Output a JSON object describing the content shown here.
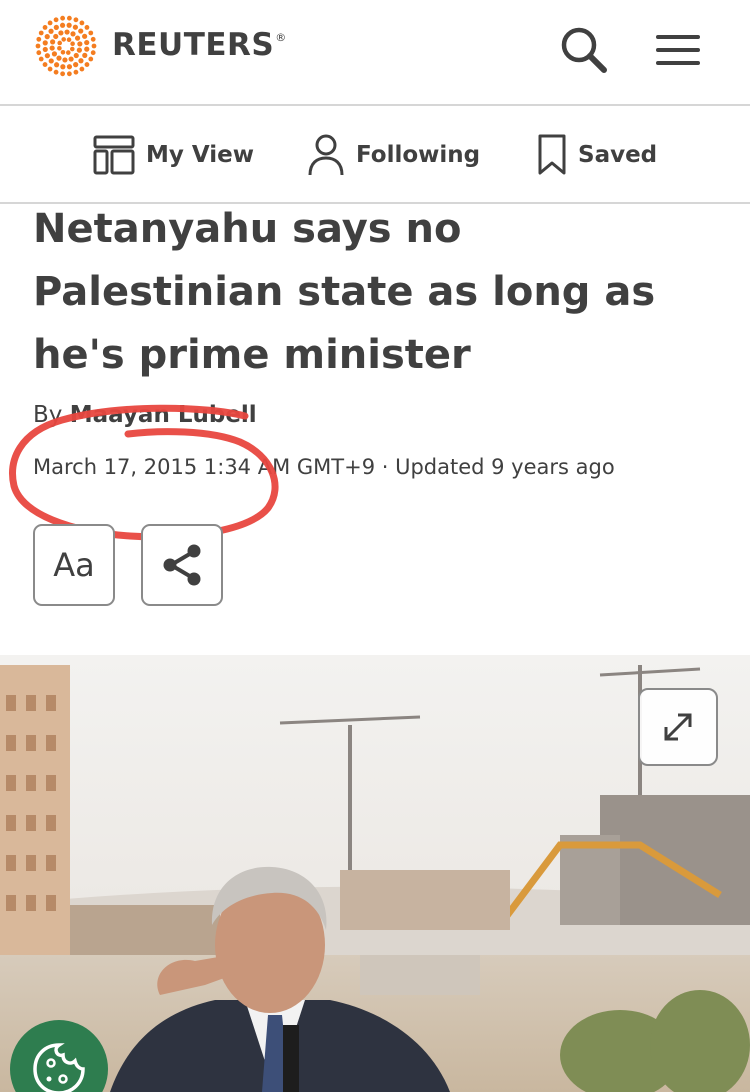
{
  "header": {
    "brand": "REUTERS",
    "brand_mark": "®",
    "icons": {
      "search": "search-icon",
      "menu": "hamburger-menu-icon"
    },
    "brand_color": "#f47d20"
  },
  "subnav": {
    "items": [
      {
        "label": "My View",
        "icon": "layout-icon"
      },
      {
        "label": "Following",
        "icon": "person-icon"
      },
      {
        "label": "Saved",
        "icon": "bookmark-icon"
      }
    ]
  },
  "article": {
    "headline": "Netanyahu says no Palestinian state as long as he's prime minister",
    "byline_prefix": "By ",
    "author": "Maayan Lubell",
    "dateline": "March 17, 2015 1:34 AM GMT+9 · Updated 9 years ago",
    "tools": {
      "text_size_label": "Aa",
      "share_icon": "share-icon"
    }
  },
  "annotation": {
    "color": "#e8473f",
    "type": "hand-drawn-circle"
  },
  "photo": {
    "expand_icon": "expand-icon",
    "cookie_icon": "cookie-icon",
    "cookie_color": "#2e7d4f"
  }
}
